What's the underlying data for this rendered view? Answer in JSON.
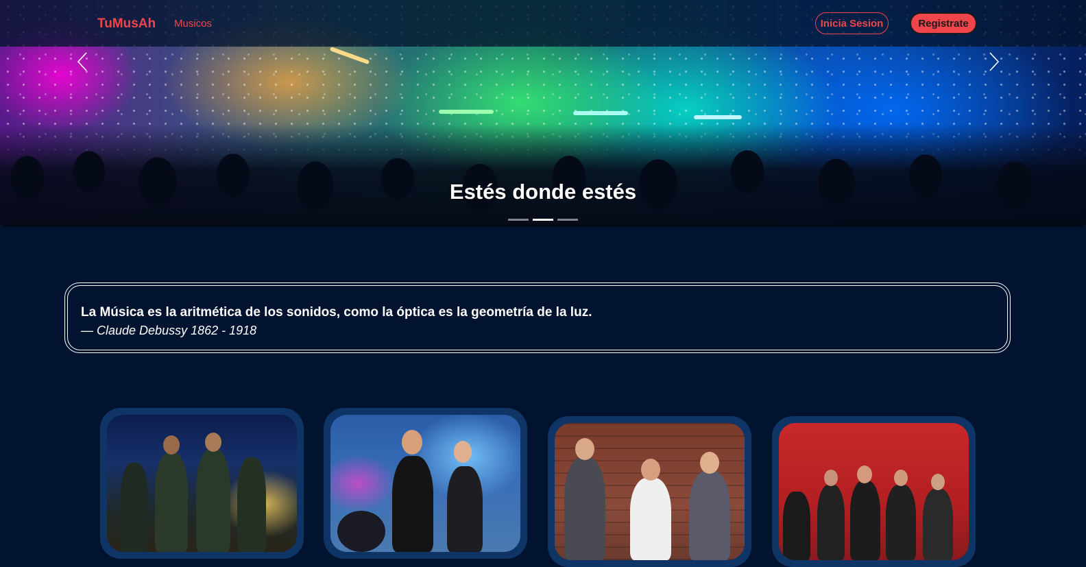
{
  "navbar": {
    "brand": "TuMusAh",
    "links": [
      {
        "label": "Musicos"
      }
    ],
    "login_label": "Inicia Sesion",
    "register_label": "Registrate"
  },
  "carousel": {
    "caption": "Estés donde estés",
    "slide_count": 3,
    "active_slide": 2
  },
  "quote": {
    "text": "La Música es la aritmética de los sonidos, como la óptica es la geometría de la luz.",
    "author": "— Claude Debussy 1862 - 1918"
  },
  "musician_cards": [
    {
      "image": "band-with-trombones-on-stage"
    },
    {
      "image": "rock-singers-in-smoke"
    },
    {
      "image": "band-with-drums-brick-wall"
    },
    {
      "image": "group-with-guitars-red-background"
    }
  ],
  "colors": {
    "background": "#021330",
    "accent": "#f0454a",
    "card_frame": "#0e3566"
  }
}
